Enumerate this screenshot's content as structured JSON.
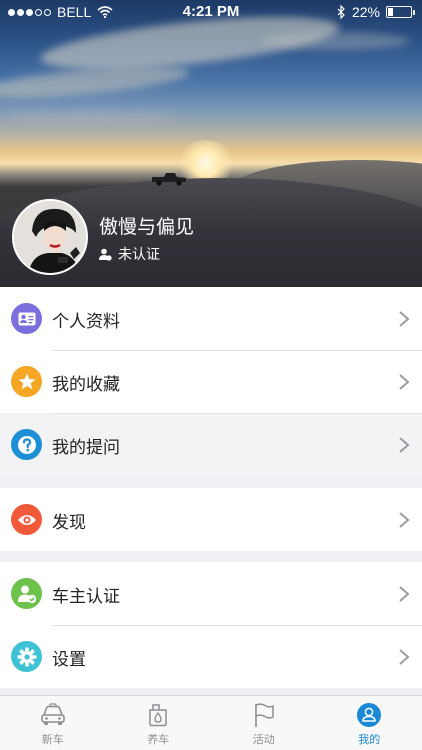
{
  "status_bar": {
    "carrier": "BELL",
    "time": "4:21 PM",
    "battery_percent": "22%",
    "battery_level": 0.22,
    "signal_bars_filled": 3,
    "signal_bars_total": 5
  },
  "profile": {
    "name": "傲慢与偏见",
    "verification_status": "未认证"
  },
  "menu": {
    "group1": [
      {
        "label": "个人资料",
        "icon": "id-card-icon",
        "color": "#7b6fdd"
      },
      {
        "label": "我的收藏",
        "icon": "star-icon",
        "color": "#f5a623"
      },
      {
        "label": "我的提问",
        "icon": "question-icon",
        "color": "#1d8fd6"
      }
    ],
    "group2": [
      {
        "label": "发现",
        "icon": "eye-icon",
        "color": "#f05a39"
      }
    ],
    "group3": [
      {
        "label": "车主认证",
        "icon": "user-check-icon",
        "color": "#6cc24a"
      },
      {
        "label": "设置",
        "icon": "gear-icon",
        "color": "#3ec2d6"
      }
    ]
  },
  "tabbar": {
    "tabs": [
      {
        "label": "新车",
        "icon": "car-icon",
        "active": false
      },
      {
        "label": "养车",
        "icon": "oil-can-icon",
        "active": false
      },
      {
        "label": "活动",
        "icon": "flag-icon",
        "active": false
      },
      {
        "label": "我的",
        "icon": "user-icon",
        "active": true
      }
    ]
  },
  "colors": {
    "accent": "#1a8ad6",
    "background": "#efeff4"
  }
}
